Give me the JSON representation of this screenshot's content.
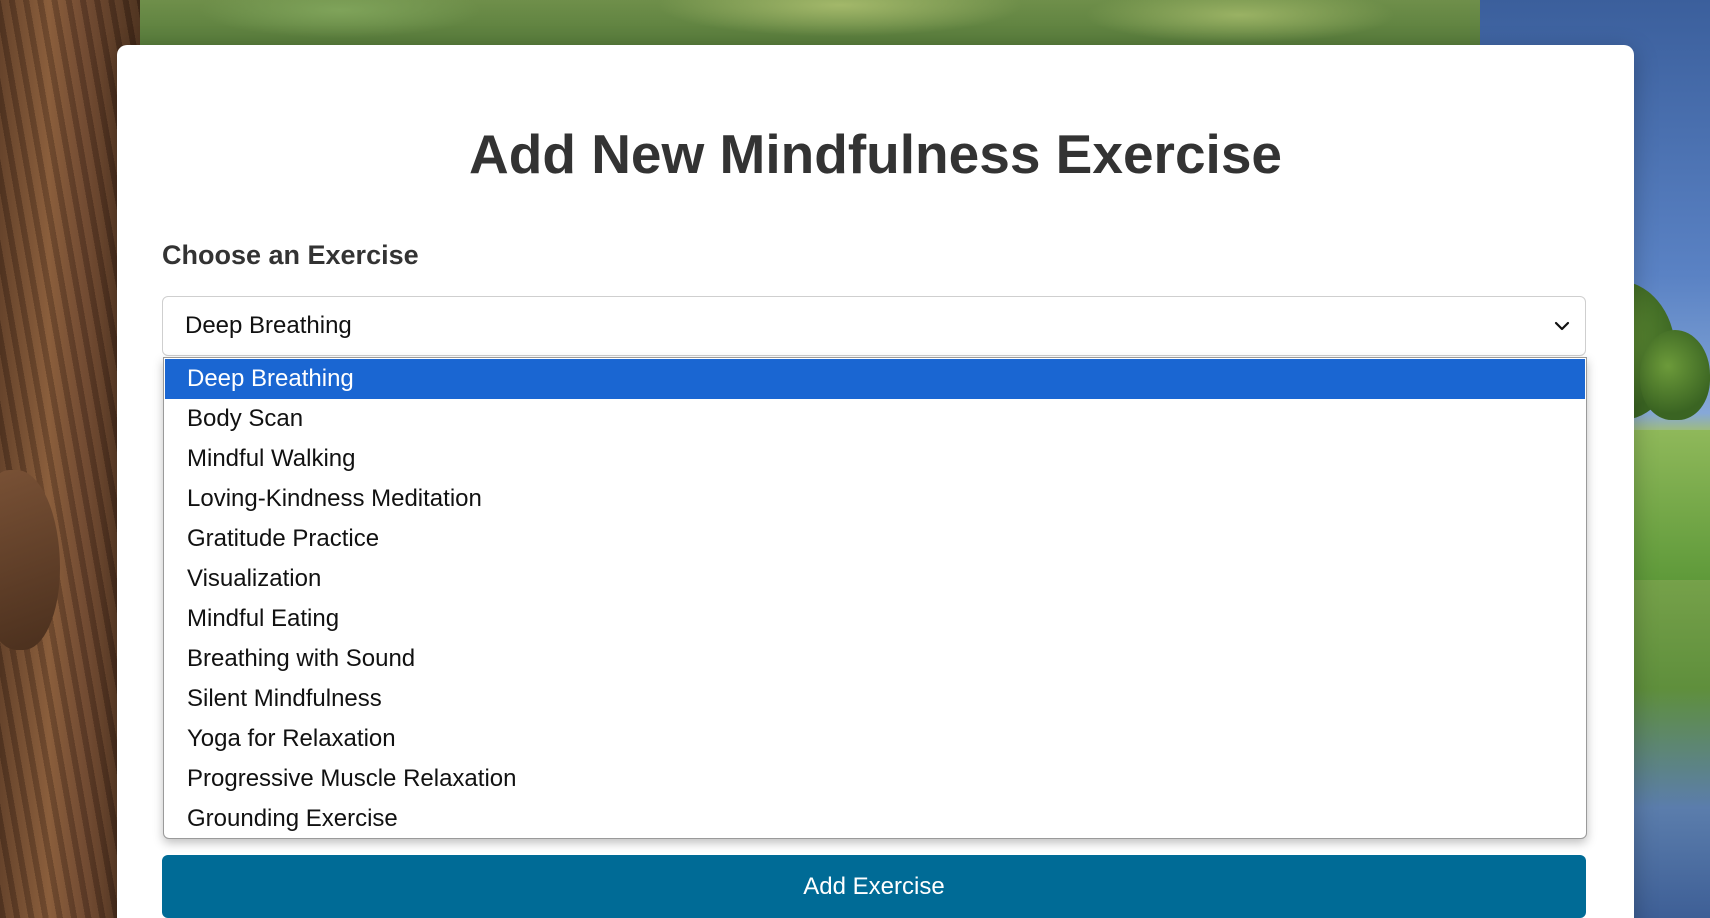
{
  "form": {
    "title": "Add New Mindfulness Exercise",
    "exercise_label": "Choose an Exercise",
    "selected_exercise": "Deep Breathing",
    "options": [
      "Deep Breathing",
      "Body Scan",
      "Mindful Walking",
      "Loving-Kindness Meditation",
      "Gratitude Practice",
      "Visualization",
      "Mindful Eating",
      "Breathing with Sound",
      "Silent Mindfulness",
      "Yoga for Relaxation",
      "Progressive Muscle Relaxation",
      "Grounding Exercise"
    ],
    "highlighted_option": "Deep Breathing",
    "submit_label": "Add Exercise"
  },
  "colors": {
    "title_text": "#333333",
    "highlight": "#1a66d2",
    "button": "#006b96",
    "card": "#ffffff"
  },
  "icons": {
    "select_toggle": "chevron-down-icon"
  }
}
